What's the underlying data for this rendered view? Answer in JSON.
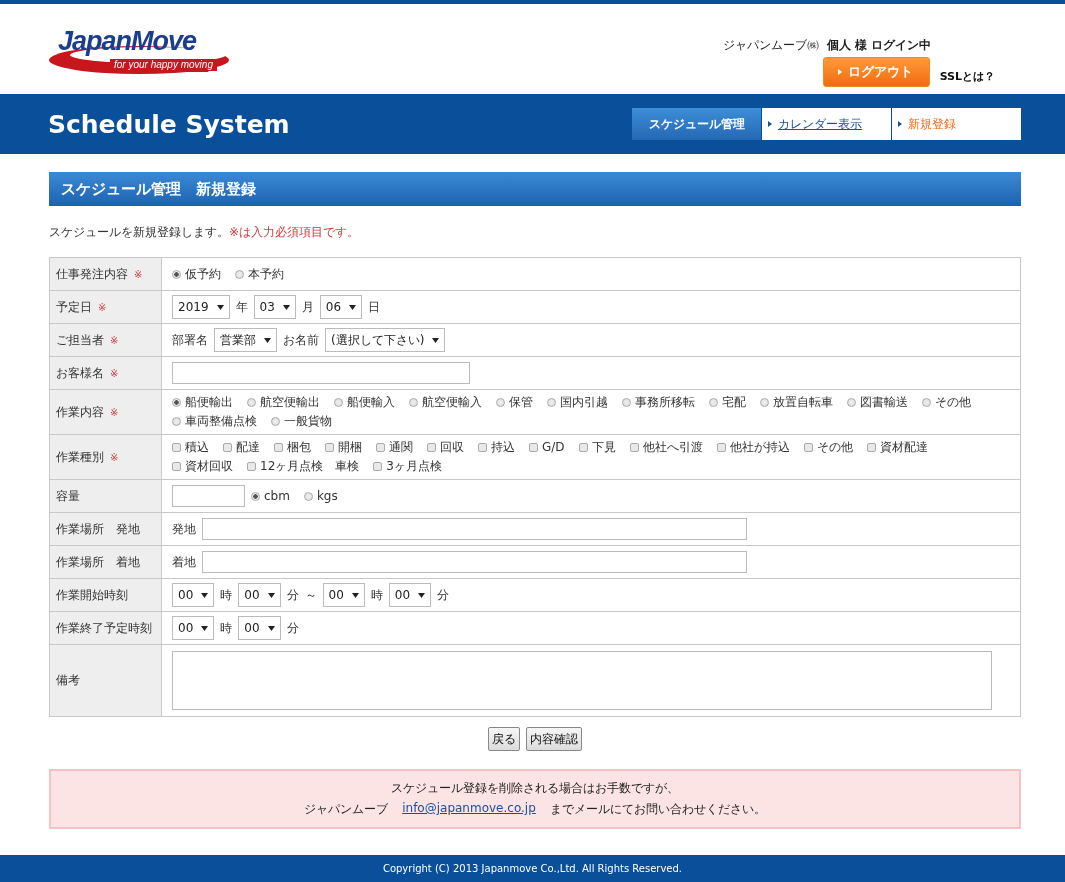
{
  "header": {
    "logo": {
      "name": "JapanMove",
      "tagline": "for your happy moving"
    },
    "company": "ジャパンムーブ㈱",
    "user": "個人 様 ログイン中",
    "logout": "ログアウト",
    "ssl_link": "SSLとは？"
  },
  "band": {
    "title": "Schedule System",
    "nav": [
      {
        "label": "スケジュール管理",
        "selected": true,
        "current": false
      },
      {
        "label": "カレンダー表示",
        "selected": false,
        "current": false
      },
      {
        "label": "新規登録",
        "selected": false,
        "current": true
      }
    ]
  },
  "page_title": "スケジュール管理　新規登録",
  "intro": {
    "text": "スケジュールを新規登録します。",
    "note": "※は入力必須項目です。"
  },
  "form": {
    "rows": [
      {
        "label": "仕事発注内容",
        "required_mark": "※",
        "parts": [
          {
            "kind": "radio",
            "label": "仮予約",
            "selected": true
          },
          {
            "kind": "radio",
            "label": "本予約",
            "selected": false
          }
        ]
      },
      {
        "label": "予定日",
        "required_mark": "※",
        "parts": [
          {
            "kind": "select",
            "value": "2019"
          },
          {
            "kind": "text",
            "text": "年"
          },
          {
            "kind": "select",
            "value": "03"
          },
          {
            "kind": "text",
            "text": "月"
          },
          {
            "kind": "select",
            "value": "06"
          },
          {
            "kind": "text",
            "text": "日"
          }
        ]
      },
      {
        "label": "ご担当者",
        "required_mark": "※",
        "parts": [
          {
            "kind": "text",
            "text": "部署名"
          },
          {
            "kind": "select",
            "value": "営業部"
          },
          {
            "kind": "text",
            "text": "お名前"
          },
          {
            "kind": "select",
            "value": "(選択して下さい)"
          }
        ]
      },
      {
        "label": "お客様名",
        "required_mark": "※",
        "parts": [
          {
            "kind": "medium-input"
          }
        ]
      },
      {
        "label": "作業内容",
        "required_mark": "※",
        "parts": [
          {
            "kind": "radio",
            "label": "船便輸出",
            "selected": true
          },
          {
            "kind": "radio",
            "label": "航空便輸出",
            "selected": false
          },
          {
            "kind": "radio",
            "label": "船便輸入",
            "selected": false
          },
          {
            "kind": "radio",
            "label": "航空便輸入",
            "selected": false
          },
          {
            "kind": "radio",
            "label": "保管",
            "selected": false
          },
          {
            "kind": "radio",
            "label": "国内引越",
            "selected": false
          },
          {
            "kind": "radio",
            "label": "事務所移転",
            "selected": false
          },
          {
            "kind": "radio",
            "label": "宅配",
            "selected": false
          },
          {
            "kind": "radio",
            "label": "放置自転車",
            "selected": false
          },
          {
            "kind": "radio",
            "label": "図書輸送",
            "selected": false
          },
          {
            "kind": "radio",
            "label": "その他",
            "selected": false
          },
          {
            "kind": "radio",
            "label": "車両整備点検",
            "selected": false
          },
          {
            "kind": "radio",
            "label": "一般貨物",
            "selected": false
          }
        ]
      },
      {
        "label": "作業種別",
        "required_mark": "※",
        "parts": [
          {
            "kind": "checkbox",
            "label": "積込",
            "checked": false
          },
          {
            "kind": "checkbox",
            "label": "配達",
            "checked": false
          },
          {
            "kind": "checkbox",
            "label": "梱包",
            "checked": false
          },
          {
            "kind": "checkbox",
            "label": "開梱",
            "checked": false
          },
          {
            "kind": "checkbox",
            "label": "通関",
            "checked": false
          },
          {
            "kind": "checkbox",
            "label": "回収",
            "checked": false
          },
          {
            "kind": "checkbox",
            "label": "持込",
            "checked": false
          },
          {
            "kind": "checkbox",
            "label": "G/D",
            "checked": false
          },
          {
            "kind": "checkbox",
            "label": "下見",
            "checked": false
          },
          {
            "kind": "checkbox",
            "label": "他社へ引渡",
            "checked": false
          },
          {
            "kind": "checkbox",
            "label": "他社が持込",
            "checked": false
          },
          {
            "kind": "checkbox",
            "label": "その他",
            "checked": false
          },
          {
            "kind": "checkbox",
            "label": "資材配達",
            "checked": false
          },
          {
            "kind": "checkbox",
            "label": "資材回収",
            "checked": false
          },
          {
            "kind": "checkbox",
            "label": "12ヶ月点検　車検",
            "checked": false
          },
          {
            "kind": "checkbox",
            "label": "3ヶ月点検",
            "checked": false
          }
        ]
      },
      {
        "label": "容量",
        "parts": [
          {
            "kind": "short-input"
          },
          {
            "kind": "radio",
            "label": "cbm",
            "selected": true
          },
          {
            "kind": "radio",
            "label": "kgs",
            "selected": false
          }
        ]
      },
      {
        "label": "作業場所　発地",
        "parts": [
          {
            "kind": "text",
            "text": "発地"
          },
          {
            "kind": "long-input"
          }
        ]
      },
      {
        "label": "作業場所　着地",
        "parts": [
          {
            "kind": "text",
            "text": "着地"
          },
          {
            "kind": "long-input"
          }
        ]
      },
      {
        "label": "作業開始時刻",
        "parts": [
          {
            "kind": "select",
            "value": "00"
          },
          {
            "kind": "text",
            "text": "時"
          },
          {
            "kind": "select",
            "value": "00"
          },
          {
            "kind": "text",
            "text": "分"
          },
          {
            "kind": "text",
            "text": "～"
          },
          {
            "kind": "select",
            "value": "00"
          },
          {
            "kind": "text",
            "text": "時"
          },
          {
            "kind": "select",
            "value": "00"
          },
          {
            "kind": "text",
            "text": "分"
          }
        ]
      },
      {
        "label": "作業終了予定時刻",
        "parts": [
          {
            "kind": "select",
            "value": "00"
          },
          {
            "kind": "text",
            "text": "時"
          },
          {
            "kind": "select",
            "value": "00"
          },
          {
            "kind": "text",
            "text": "分"
          }
        ]
      },
      {
        "label": "備考",
        "parts": [
          {
            "kind": "textarea"
          }
        ]
      }
    ]
  },
  "buttons": [
    "戻る",
    "内容確認"
  ],
  "notice": {
    "line1": "スケジュール登録を削除される場合はお手数ですが、",
    "before": "ジャパンムーブ",
    "email": "info@japanmove.co.jp",
    "after": "までメールにてお問い合わせください。"
  },
  "footer": "Copyright (C) 2013 Japanmove Co.,Ltd. All Rights Reserved."
}
